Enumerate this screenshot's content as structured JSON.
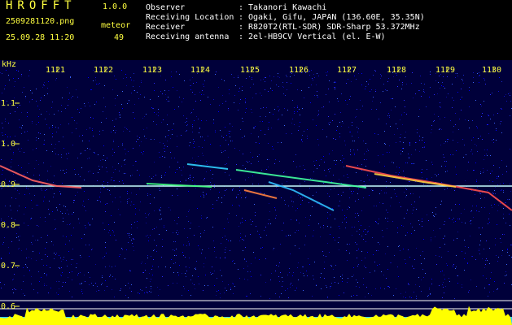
{
  "header": {
    "app_title": "HROFFT",
    "app_version": "1.0.0",
    "file_name": "2509281120.png",
    "date_time": "25.09.28 11:20",
    "meteor_label": "meteor",
    "meteor_count": "49"
  },
  "info": [
    {
      "label": "Observer",
      "value": "Takanori Kawachi"
    },
    {
      "label": "Receiving Location",
      "value": "Ogaki, Gifu, JAPAN (136.60E, 35.35N)"
    },
    {
      "label": "Receiver",
      "value": "R820T2(RTL-SDR) SDR-Sharp 53.372MHz"
    },
    {
      "label": "Receiving antenna",
      "value": "2el-HB9CV Vertical (el. E-W)"
    }
  ],
  "plot": {
    "unit_label": "kHz",
    "time_ticks": [
      "1121",
      "1122",
      "1123",
      "1124",
      "1125",
      "1126",
      "1127",
      "1128",
      "1129",
      "1130"
    ],
    "freq_ticks": [
      "1.1",
      "1.0",
      "0.9",
      "0.8",
      "0.7",
      "0.6"
    ],
    "colors": {
      "background": "#00003a",
      "axis_text": "#ffff40",
      "carrier": "#c8ffff",
      "activity": "#ffff00",
      "grid": "#ffffff"
    }
  }
}
